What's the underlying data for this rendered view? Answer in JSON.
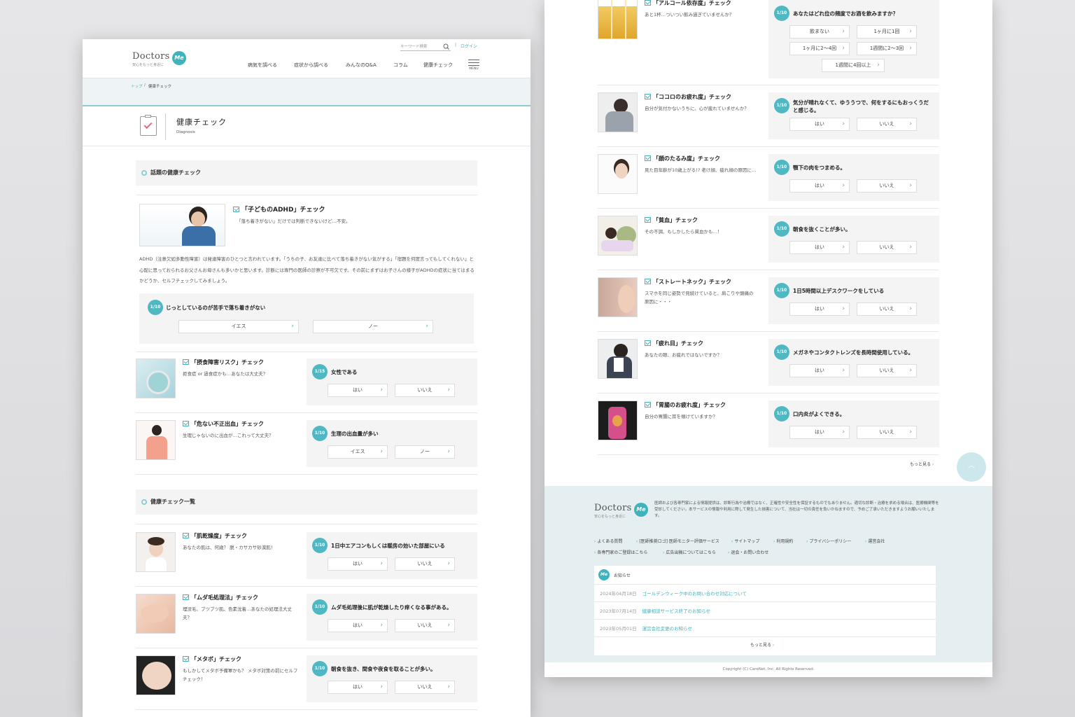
{
  "header": {
    "logo_text": "Doctors",
    "logo_badge": "Me",
    "logo_sub": "安心をもっと身近に",
    "search_placeholder": "キーワード検索",
    "login": "ログイン",
    "nav": [
      "病気を調べる",
      "症状から調べる",
      "みんなのQ&A",
      "コラム",
      "健康チェック"
    ],
    "menu_label": "MENU"
  },
  "breadcrumb": {
    "home": "トップ",
    "sep": "/",
    "current": "健康チェック"
  },
  "page_title": {
    "title": "健康チェック",
    "sub": "Diagnosis"
  },
  "featured": {
    "heading": "話題の健康チェック",
    "title": "「子どものADHD」チェック",
    "subtitle": "「落ち着きがない」だけでは判断できないけど…不安。",
    "body": "ADHD（注意欠如多動性障害）は発達障害のひとつと言われています。「うちの子、お友達に比べて落ち着きがない気がする」「宿題を何度言ってもしてくれない」と心配に思っておられるお父さんお母さんも多いかと思います。診断には専門の医師の診察が不可欠です。その前にまずはお子さんの様子がADHDの症状に当てはまるかどうか、セルフチェックしてみましょう。",
    "question": {
      "num": "1/10",
      "text": "じっとしているのが苦手で落ち着きがない",
      "options": [
        "イエス",
        "ノー"
      ]
    }
  },
  "featured_cards": [
    {
      "title": "「摂食障害リスク」チェック",
      "desc": "拒食症 or 過食症かも…あなたは大丈夫？",
      "num": "1/15",
      "q": "女性である",
      "options": [
        "はい",
        "いいえ"
      ]
    },
    {
      "title": "「危ない不正出血」チェック",
      "desc": "生理じゃないのに出血が…これって大丈夫？",
      "num": "1/10",
      "q": "生理の出血量が多い",
      "options": [
        "イエス",
        "ノー"
      ]
    }
  ],
  "list": {
    "heading": "健康チェック一覧",
    "left_items": [
      {
        "title": "「肌乾燥度」チェック",
        "desc": "あなたの肌は、何歳？ 脱・カサカサ砂漠肌！",
        "num": "1/10",
        "q": "1日中エアコンもしくは暖房の効いた部屋にいる",
        "options": [
          "はい",
          "いいえ"
        ]
      },
      {
        "title": "「ムダ毛処理法」チェック",
        "desc": "埋没毛、ブツブツ肌、色素沈着…あなたの処理法大丈夫？",
        "num": "1/10",
        "q": "ムダ毛処理後に肌が乾燥したり痒くなる事がある。",
        "options": [
          "はい",
          "いいえ"
        ]
      },
      {
        "title": "「メタボ」チェック",
        "desc": "もしかしてメタボ予備軍かも？ メタボ対策の前にセルフチェック！",
        "num": "1/10",
        "q": "朝食を抜き、間食や夜食を取ることが多い。",
        "options": [
          "はい",
          "いいえ"
        ]
      }
    ],
    "right_items": [
      {
        "title": "「アルコール依存度」チェック",
        "desc": "あと1杯…ついつい飲み過ぎていませんか？",
        "num": "1/10",
        "q": "あなたはどれ位の頻度でお酒を飲みますか？",
        "options": [
          "飲まない",
          "1ヶ月に1回",
          "1ヶ月に2〜4回",
          "1週間に2〜3回",
          "1週間に4回以上"
        ]
      },
      {
        "title": "「ココロのお疲れ度」チェック",
        "desc": "自分が気付かないうちに、心が疲れていませんか？",
        "num": "1/10",
        "q": "気分が晴れなくて、ゆううつで、何をするにもおっくうだと感じる。",
        "options": [
          "はい",
          "いいえ"
        ]
      },
      {
        "title": "「顔のたるみ度」チェック",
        "desc": "見た目年齢が10歳上がる!? 老け顔、疲れ顔の原因に…",
        "num": "1/10",
        "q": "顎下の肉をつまめる。",
        "options": [
          "はい",
          "いいえ"
        ]
      },
      {
        "title": "「貧血」チェック",
        "desc": "その不調、もしかしたら貧血かも…！",
        "num": "1/10",
        "q": "朝食を抜くことが多い。",
        "options": [
          "はい",
          "いいえ"
        ]
      },
      {
        "title": "「ストレートネック」チェック",
        "desc": "スマホを同じ姿勢で見続けていると、肩こりや頭痛の原因に・・・",
        "num": "1/10",
        "q": "1日5時間以上デスクワークをしている",
        "options": [
          "はい",
          "いいえ"
        ]
      },
      {
        "title": "「疲れ目」チェック",
        "desc": "あなたの眼、お疲れではないですか？",
        "num": "1/10",
        "q": "メガネやコンタクトレンズを長時間使用している。",
        "options": [
          "はい",
          "いいえ"
        ]
      },
      {
        "title": "「胃腸のお疲れ度」チェック",
        "desc": "自分の胃腸に耳を傾けていますか？",
        "num": "1/10",
        "q": "口内炎がよくできる。",
        "options": [
          "はい",
          "いいえ"
        ]
      }
    ],
    "more": "もっと見る"
  },
  "footer": {
    "disclaimer": "医師および各専門家による情報提供は、診断行為や治療ではなく、正確性や安全性を保証するものでもありません。適切な診断・治療を求める場合は、医療機関等を受診してください。本サービスの情報や利用に際して発生した損害について、当社は一切の責任を負いかねますので、予めご了承いただきますようお願いいたします。",
    "links_row1": [
      "よくある質問",
      "[医師推奨ロゴ] 医師モニター評価サービス",
      "サイトマップ",
      "利用規約",
      "プライバシーポリシー",
      "運営会社"
    ],
    "links_row2": [
      "各専門家のご登録はこちら",
      "広告出稿についてはこちら",
      "退会・お問い合わせ"
    ],
    "news_label": "お知らせ",
    "news": [
      {
        "date": "2024年04月18日",
        "text": "ゴールデンウィーク中のお問い合わせ対応について"
      },
      {
        "date": "2023年07月14日",
        "text": "健康相談サービス終了のお知らせ"
      },
      {
        "date": "2023年05月01日",
        "text": "運営会社変更のお知らせ"
      }
    ],
    "news_more": "もっと見る",
    "copyright": "Copyright (C) CareNet, Inc. All Rights Reserved."
  },
  "colors": {
    "accent": "#3fb3bd",
    "panel": "#f4f4f4",
    "footer_bg": "#e5eef0"
  }
}
